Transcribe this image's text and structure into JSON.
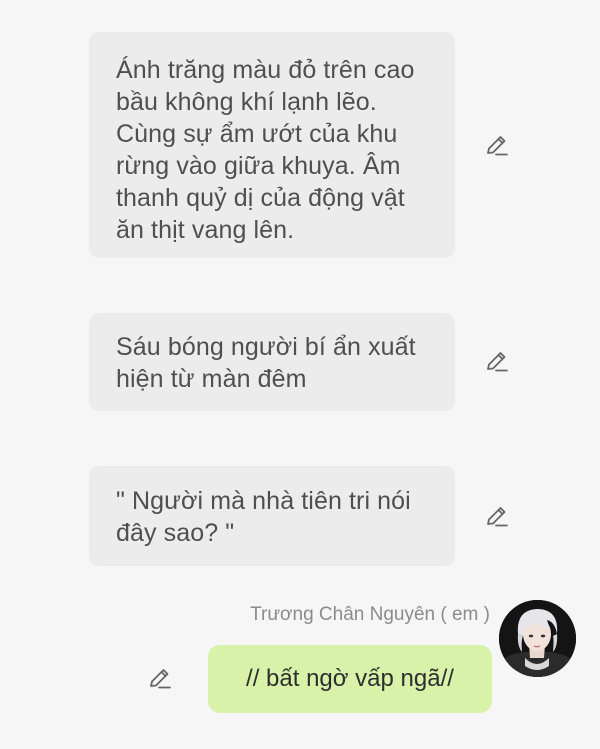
{
  "messages": [
    {
      "text": "Ánh trăng màu đỏ trên cao bầu không khí lạnh lẽo. Cùng sự ẩm ướt của khu rừng vào giữa khuya. Âm thanh quỷ dị của động vật ăn thịt vang lên."
    },
    {
      "text": "Sáu bóng người bí ẩn xuất hiện từ màn đêm"
    },
    {
      "text": "\" Người mà nhà tiên tri nói đây sao? \""
    }
  ],
  "reply": {
    "sender_name": "Trương Chân Nguyên ( em )",
    "text": "// bất ngờ vấp ngã//"
  },
  "icons": {
    "edit": "pencil-edit-icon",
    "avatar": "user-avatar"
  },
  "colors": {
    "background": "#f6f6f6",
    "bubble": "#ececec",
    "reply_bubble": "#d8f2a9",
    "text": "#4f4f4f",
    "name": "#8b8b8b"
  }
}
